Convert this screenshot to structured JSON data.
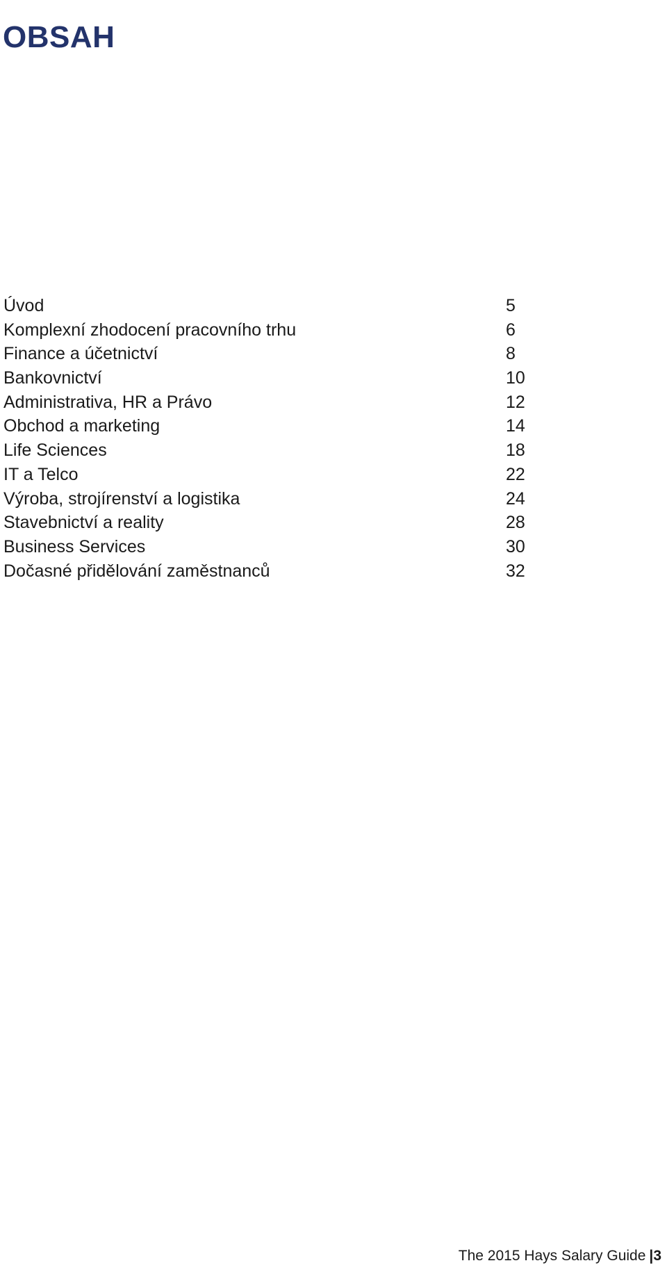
{
  "document": {
    "title": "OBSAH",
    "title_color": "#23336b",
    "body_text_color": "#1a1a1a"
  },
  "toc": {
    "entries": [
      {
        "label": "Úvod",
        "page": "5"
      },
      {
        "label": "Komplexní zhodocení pracovního trhu",
        "page": "6"
      },
      {
        "label": "Finance a účetnictví",
        "page": "8"
      },
      {
        "label": "Bankovnictví",
        "page": "10"
      },
      {
        "label": "Administrativa, HR a Právo",
        "page": "12"
      },
      {
        "label": "Obchod a marketing",
        "page": "14"
      },
      {
        "label": "Life Sciences",
        "page": "18"
      },
      {
        "label": "IT a Telco",
        "page": "22"
      },
      {
        "label": "Výroba, strojírenství a logistika",
        "page": "24"
      },
      {
        "label": "Stavebnictví a reality",
        "page": "28"
      },
      {
        "label": "Business Services",
        "page": "30"
      },
      {
        "label": "Dočasné přidělování zaměstnanců",
        "page": "32"
      }
    ]
  },
  "footer": {
    "text": "The 2015 Hays Salary Guide",
    "separator": "|",
    "page_number": "3"
  }
}
